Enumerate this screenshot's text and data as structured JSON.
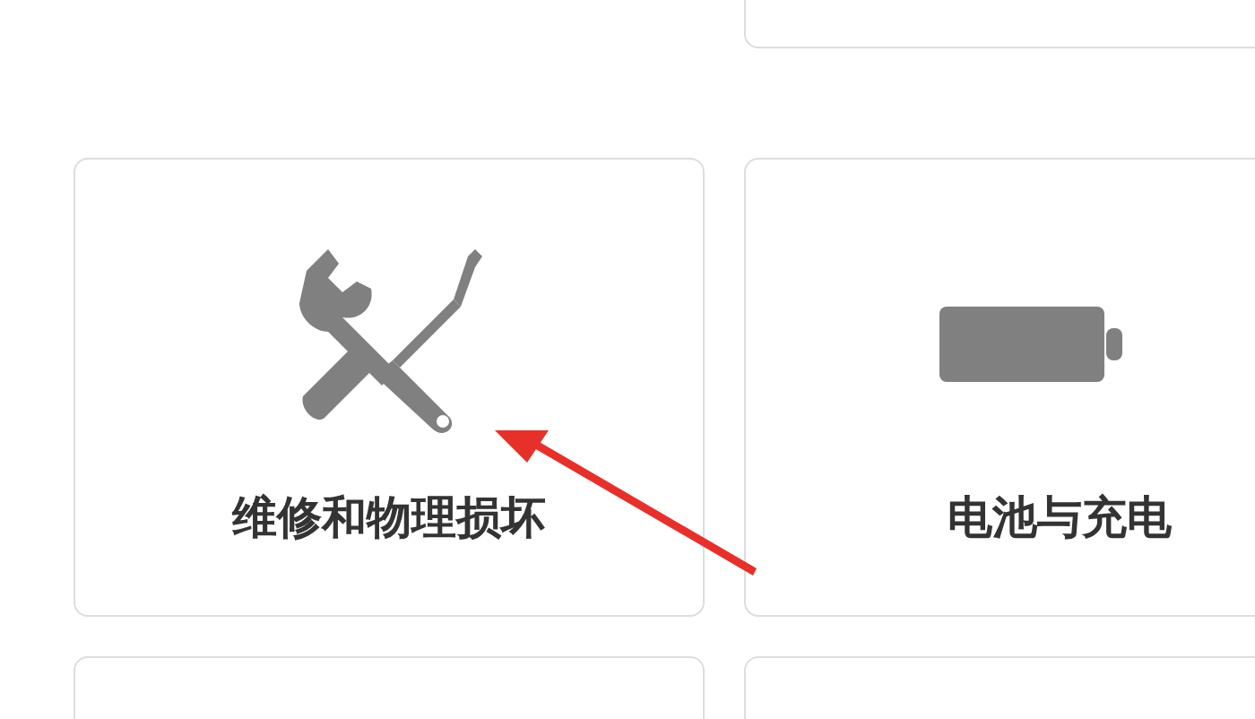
{
  "cards": [
    {
      "kind": "tools",
      "title": "维修和物理损坏"
    },
    {
      "kind": "battery",
      "title": "电池与充电"
    }
  ],
  "annotation": {
    "kind": "arrow"
  }
}
